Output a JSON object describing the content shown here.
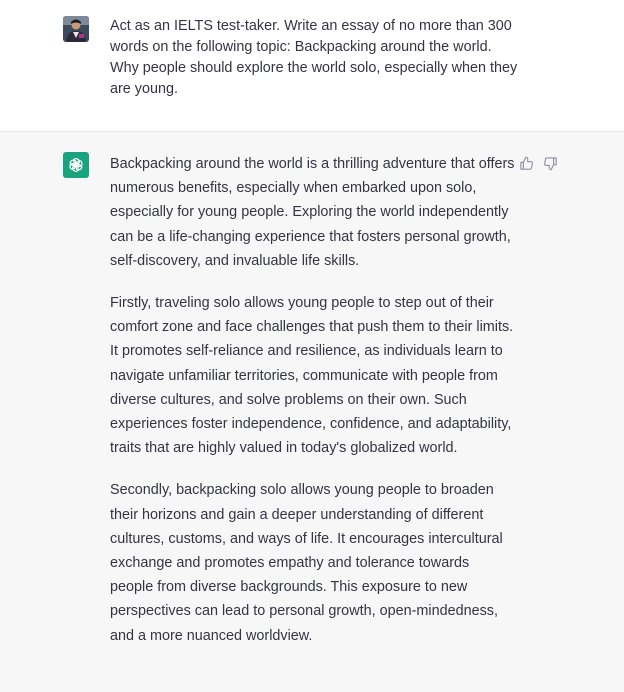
{
  "user_message": {
    "avatar_icon": "user-avatar-photo",
    "text": "Act as an IELTS test-taker. Write an essay of no more than 300 words on the following topic: Backpacking around the world. Why people should explore the world solo, especially when they are young."
  },
  "assistant_message": {
    "avatar_icon": "chatgpt-logo-icon",
    "avatar_color": "#19a37f",
    "paragraphs": [
      "Backpacking around the world is a thrilling adventure that offers numerous benefits, especially when embarked upon solo, especially for young people. Exploring the world independently can be a life-changing experience that fosters personal growth, self-discovery, and invaluable life skills.",
      "Firstly, traveling solo allows young people to step out of their comfort zone and face challenges that push them to their limits. It promotes self-reliance and resilience, as individuals learn to navigate unfamiliar territories, communicate with people from diverse cultures, and solve problems on their own. Such experiences foster independence, confidence, and adaptability, traits that are highly valued in today's globalized world.",
      "Secondly, backpacking solo allows young people to broaden their horizons and gain a deeper understanding of different cultures, customs, and ways of life. It encourages intercultural exchange and promotes empathy and tolerance towards people from diverse backgrounds. This exposure to new perspectives can lead to personal growth, open-mindedness, and a more nuanced worldview."
    ],
    "feedback_icons": [
      "thumbs-up-icon",
      "thumbs-down-icon"
    ]
  }
}
